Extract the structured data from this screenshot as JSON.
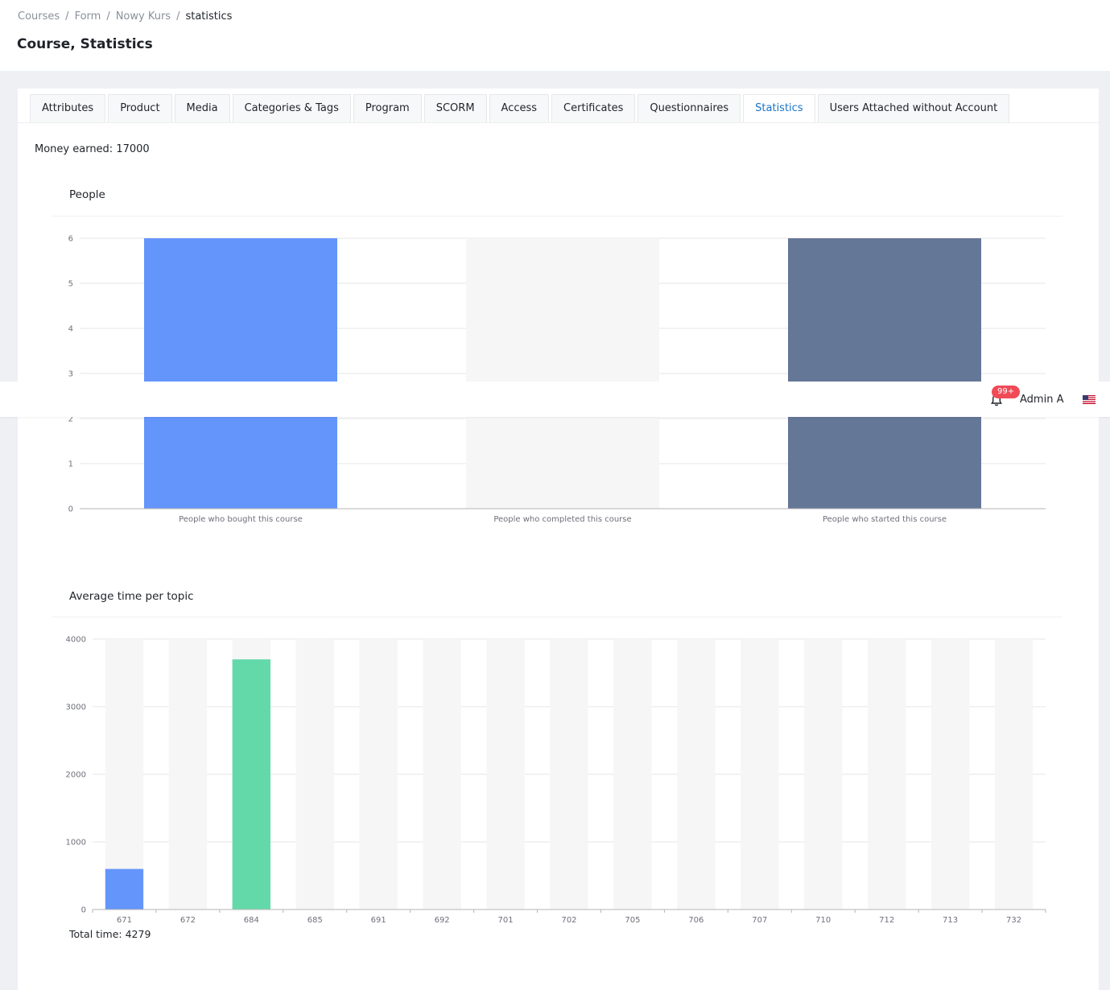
{
  "breadcrumb": [
    "Courses",
    "Form",
    "Nowy Kurs",
    "statistics"
  ],
  "page_title": "Course, Statistics",
  "tabs": [
    {
      "label": "Attributes",
      "active": false
    },
    {
      "label": "Product",
      "active": false
    },
    {
      "label": "Media",
      "active": false
    },
    {
      "label": "Categories & Tags",
      "active": false
    },
    {
      "label": "Program",
      "active": false
    },
    {
      "label": "SCORM",
      "active": false
    },
    {
      "label": "Access",
      "active": false
    },
    {
      "label": "Certificates",
      "active": false
    },
    {
      "label": "Questionnaires",
      "active": false
    },
    {
      "label": "Statistics",
      "active": true
    },
    {
      "label": "Users Attached without Account",
      "active": false
    }
  ],
  "stats": {
    "money_earned": "Money earned: 17000",
    "total_time": "Total time: 4279"
  },
  "colors": {
    "accent": "#1a73c8",
    "bar_blue": "#6495fa",
    "bar_slate": "#657797",
    "bar_green": "#63d9a9",
    "bar_background": "#f6f6f6",
    "badge": "#f04a57"
  },
  "topbar": {
    "badge": "99+",
    "user_name": "Admin A",
    "bell_icon": "bell-icon",
    "flag_icon": "us-flag-icon"
  },
  "chart_data": [
    {
      "type": "bar",
      "title": "People",
      "categories": [
        "People who bought this course",
        "People who completed this course",
        "People who started this course"
      ],
      "values": [
        6,
        0,
        6
      ],
      "bar_colors": [
        "#6495fa",
        "#f6f6f6",
        "#657797"
      ],
      "yticks": [
        0,
        1,
        2,
        3,
        4,
        5,
        6
      ],
      "ylim": [
        0,
        6
      ],
      "show_background": true,
      "grid": true,
      "legend": "none"
    },
    {
      "type": "bar",
      "title": "Average time per topic",
      "categories": [
        "671",
        "672",
        "684",
        "685",
        "691",
        "692",
        "701",
        "702",
        "705",
        "706",
        "707",
        "710",
        "712",
        "713",
        "732"
      ],
      "values": [
        600,
        0,
        3700,
        0,
        0,
        0,
        0,
        0,
        0,
        0,
        0,
        0,
        0,
        0,
        0
      ],
      "bar_colors": [
        "#6495fa",
        "#6495fa",
        "#63d9a9",
        "#6495fa",
        "#6495fa",
        "#6495fa",
        "#6495fa",
        "#6495fa",
        "#6495fa",
        "#6495fa",
        "#6495fa",
        "#6495fa",
        "#6495fa",
        "#6495fa",
        "#6495fa"
      ],
      "yticks": [
        0,
        1000,
        2000,
        3000,
        4000
      ],
      "ylim": [
        0,
        4000
      ],
      "show_background": true,
      "grid": true,
      "legend": "none"
    }
  ]
}
